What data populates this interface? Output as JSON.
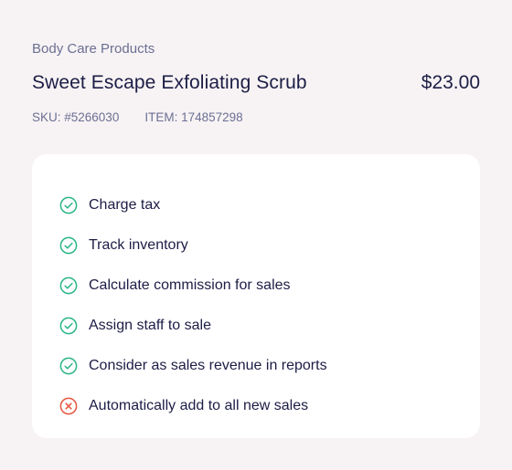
{
  "product": {
    "category": "Body Care Products",
    "name": "Sweet Escape Exfoliating Scrub",
    "price": "$23.00",
    "sku": "SKU: #5266030",
    "item": "ITEM: 174857298"
  },
  "colors": {
    "background": "#f7f3f4",
    "card": "#ffffff",
    "text_primary": "#1c1d45",
    "text_secondary": "#6b6f93",
    "enabled": "#2bb58a",
    "disabled": "#e5553f"
  },
  "settings": [
    {
      "label": "Charge tax",
      "icon": "check-circle-icon",
      "enabled": true
    },
    {
      "label": "Track inventory",
      "icon": "check-circle-icon",
      "enabled": true
    },
    {
      "label": "Calculate commission for sales",
      "icon": "check-circle-icon",
      "enabled": true
    },
    {
      "label": "Assign staff to sale",
      "icon": "check-circle-icon",
      "enabled": true
    },
    {
      "label": "Consider as sales revenue in reports",
      "icon": "check-circle-icon",
      "enabled": true
    },
    {
      "label": "Automatically add to all new sales",
      "icon": "x-circle-icon",
      "enabled": false
    }
  ]
}
